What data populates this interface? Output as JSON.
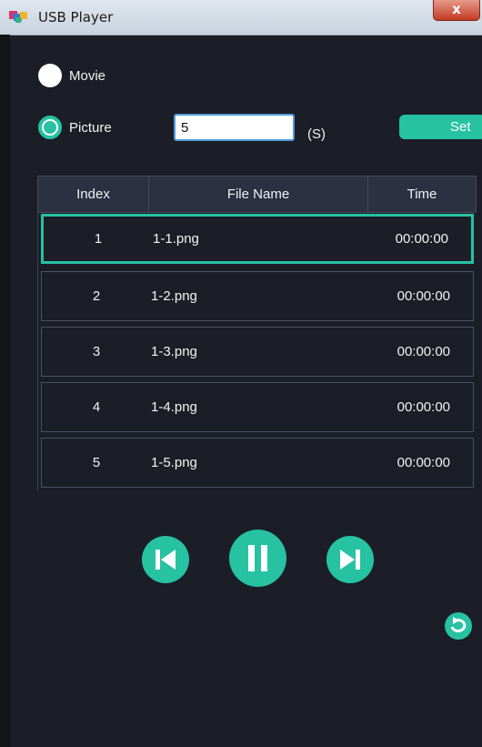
{
  "window": {
    "title": "USB Player",
    "close_label": "x"
  },
  "mode": {
    "options": [
      {
        "label": "Movie",
        "selected": false
      },
      {
        "label": "Picture",
        "selected": true
      }
    ]
  },
  "interval": {
    "value": "5",
    "unit": "(S)",
    "set_label": "Set"
  },
  "table": {
    "headers": {
      "index": "Index",
      "file_name": "File Name",
      "time": "Time"
    },
    "rows": [
      {
        "index": "1",
        "file_name": "1-1.png",
        "time": "00:00:00",
        "selected": true
      },
      {
        "index": "2",
        "file_name": "1-2.png",
        "time": "00:00:00",
        "selected": false
      },
      {
        "index": "3",
        "file_name": "1-3.png",
        "time": "00:00:00",
        "selected": false
      },
      {
        "index": "4",
        "file_name": "1-4.png",
        "time": "00:00:00",
        "selected": false
      },
      {
        "index": "5",
        "file_name": "1-5.png",
        "time": "00:00:00",
        "selected": false
      }
    ]
  },
  "controls": {
    "previous_icon": "skip-previous-icon",
    "pause_icon": "pause-icon",
    "next_icon": "skip-next-icon",
    "loop_icon": "repeat-icon"
  },
  "colors": {
    "accent": "#26c2a2",
    "background": "#1b1e27",
    "header": "#2b3140"
  }
}
